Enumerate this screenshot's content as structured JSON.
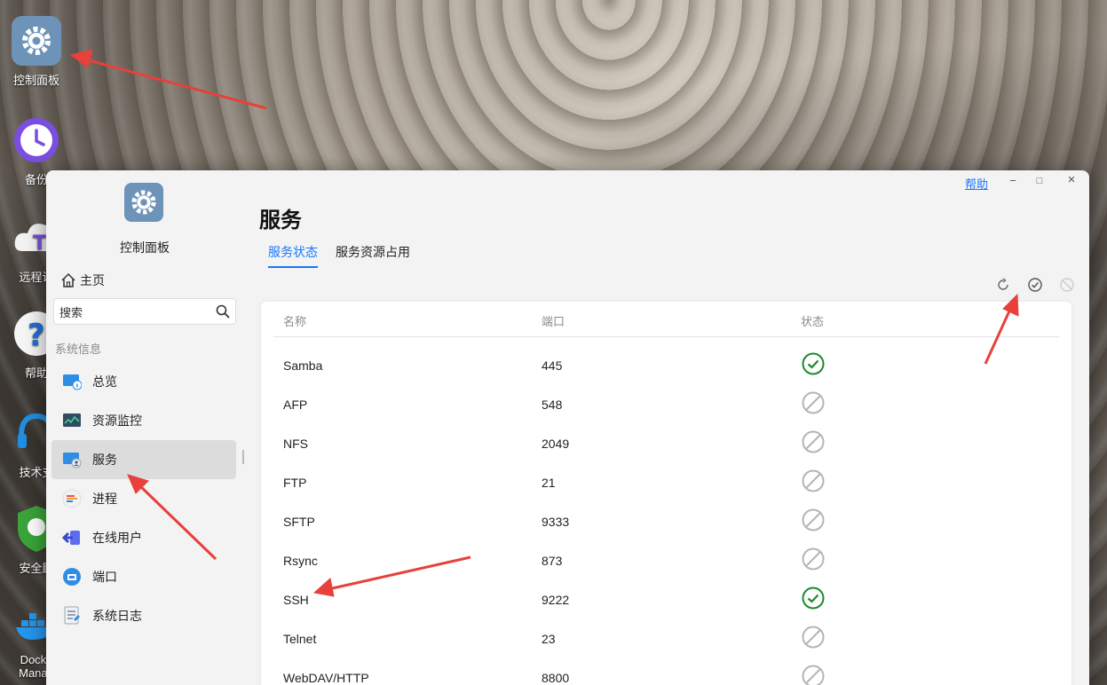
{
  "desktop": {
    "icons": [
      {
        "label": "控制面板",
        "icon": "gear-icon"
      },
      {
        "label": "备份",
        "icon": "clock-icon"
      },
      {
        "label": "远程访",
        "icon": "cloud-icon"
      },
      {
        "label": "帮助",
        "icon": "question-icon"
      },
      {
        "label": "技术支",
        "icon": "headset-icon"
      },
      {
        "label": "安全顾",
        "icon": "shield-icon"
      },
      {
        "label": "Docke Manag",
        "icon": "docker-icon"
      }
    ]
  },
  "sidebar": {
    "title": "控制面板",
    "home": "主页",
    "search_placeholder": "搜索",
    "section": "系统信息",
    "items": [
      {
        "label": "总览",
        "icon": "monitor-info-icon"
      },
      {
        "label": "资源监控",
        "icon": "chart-monitor-icon"
      },
      {
        "label": "服务",
        "icon": "service-icon",
        "active": true
      },
      {
        "label": "进程",
        "icon": "process-icon"
      },
      {
        "label": "在线用户",
        "icon": "user-login-icon"
      },
      {
        "label": "端口",
        "icon": "port-icon"
      },
      {
        "label": "系统日志",
        "icon": "log-icon"
      }
    ]
  },
  "window": {
    "help": "帮助",
    "minimize": "−",
    "maximize": "□",
    "close": "×"
  },
  "main": {
    "title": "服务",
    "tabs": [
      {
        "label": "服务状态",
        "active": true
      },
      {
        "label": "服务资源占用",
        "active": false
      }
    ],
    "table": {
      "headers": [
        "名称",
        "端口",
        "状态"
      ],
      "rows": [
        {
          "name": "Samba",
          "port": "445",
          "status": "enabled"
        },
        {
          "name": "AFP",
          "port": "548",
          "status": "disabled"
        },
        {
          "name": "NFS",
          "port": "2049",
          "status": "disabled"
        },
        {
          "name": "FTP",
          "port": "21",
          "status": "disabled"
        },
        {
          "name": "SFTP",
          "port": "9333",
          "status": "disabled"
        },
        {
          "name": "Rsync",
          "port": "873",
          "status": "disabled"
        },
        {
          "name": "SSH",
          "port": "9222",
          "status": "enabled"
        },
        {
          "name": "Telnet",
          "port": "23",
          "status": "disabled"
        },
        {
          "name": "WebDAV/HTTP",
          "port": "8800",
          "status": "disabled"
        }
      ]
    }
  },
  "colors": {
    "accent": "#1677ff",
    "enabled": "#1a8a2e",
    "disabled": "#b5b5b5",
    "annotation": "#e8403a"
  }
}
